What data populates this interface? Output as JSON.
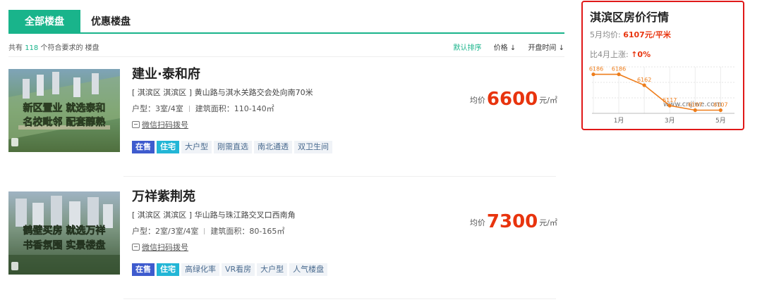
{
  "tabs": [
    {
      "label": "全部楼盘",
      "active": true
    },
    {
      "label": "优惠楼盘",
      "active": false
    }
  ],
  "results": {
    "prefix": "共有",
    "count": "118",
    "suffix": "个符合要求的 楼盘"
  },
  "sort": {
    "default": "默认排序",
    "price": "价格 ↓",
    "open_date": "开盘时间 ↓"
  },
  "listings": [
    {
      "title": "建业·泰和府",
      "address": "[ 淇滨区 淇滨区 ] 黄山路与淇水关路交会处向南70米",
      "layout": "户型：3室/4室",
      "area": "建筑面积：110-140㎡",
      "wechat": "微信扫码拨号",
      "price_prefix": "均价",
      "price": "6600",
      "price_unit": "元/㎡",
      "tags": [
        "在售",
        "住宅",
        "大户型",
        "刚需直选",
        "南北通透",
        "双卫生间"
      ],
      "image_text": [
        "新区置业 就选泰和",
        "名校毗邻 配套醇熟"
      ]
    },
    {
      "title": "万祥紫荆苑",
      "address": "[ 淇滨区 淇滨区 ] 华山路与珠江路交叉口西南角",
      "layout": "户型：2室/3室/4室",
      "area": "建筑面积：80-165㎡",
      "wechat": "微信扫码拨号",
      "price_prefix": "均价",
      "price": "7300",
      "price_unit": "元/㎡",
      "tags": [
        "在售",
        "住宅",
        "高绿化率",
        "VR看房",
        "大户型",
        "人气楼盘"
      ],
      "image_text": [
        "鹤壁买房 就选万祥",
        "书香氛围 实景楼盘"
      ]
    }
  ],
  "price_widget": {
    "title": "淇滨区房价行情",
    "avg_label": "5月均价:",
    "avg_value": "6107元/平米",
    "rise_label": "比4月上涨:",
    "rise_value": "↑0%",
    "watermark": "www.cnjiwe.com",
    "border_color": "#e01818"
  },
  "chart_data": {
    "type": "line",
    "x": [
      "",
      "1月",
      "",
      "3月",
      "",
      "5月"
    ],
    "values": [
      6186,
      6186,
      6162,
      6117,
      6107,
      6107
    ],
    "data_labels": [
      "6186",
      "6186",
      "6162",
      "6117",
      "6107",
      "6107"
    ],
    "tick_labels": [
      "1月",
      "3月",
      "5月"
    ],
    "ylim": [
      6100,
      6190
    ],
    "line_color": "#ee7d1b",
    "grid": true
  },
  "colors": {
    "accent": "#19b48b",
    "price": "#e8340e",
    "tag_sale": "#3e5bce",
    "tag_type": "#22b6d6"
  }
}
